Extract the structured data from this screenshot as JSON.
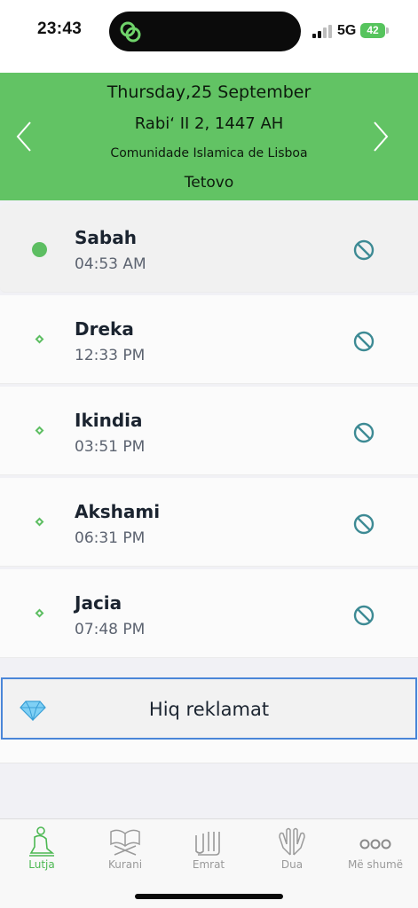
{
  "status_bar": {
    "time": "23:43",
    "network": "5G",
    "battery": "42"
  },
  "header": {
    "gregorian_date": "Thursday,25 September",
    "hijri_date": "Rabiʻ II 2, 1447 AH",
    "calculation_source": "Comunidade Islamica de Lisboa",
    "city": "Tetovo",
    "background_color": "#62c364"
  },
  "prayers": [
    {
      "name": "Sabah",
      "time": "04:53 AM",
      "current": true
    },
    {
      "name": "Dreka",
      "time": "12:33 PM",
      "current": false
    },
    {
      "name": "Ikindia",
      "time": "03:51 PM",
      "current": false
    },
    {
      "name": "Akshami",
      "time": "06:31 PM",
      "current": false
    },
    {
      "name": "Jacia",
      "time": "07:48 PM",
      "current": false
    }
  ],
  "remove_ads": {
    "label": "Hiq reklamat",
    "icon": "diamond-icon"
  },
  "tabs": [
    {
      "label": "Lutja",
      "icon": "praying-person-icon",
      "active": true
    },
    {
      "label": "Kurani",
      "icon": "quran-stand-icon",
      "active": false
    },
    {
      "label": "Emrat",
      "icon": "allah-calligraphy-icon",
      "active": false
    },
    {
      "label": "Dua",
      "icon": "praying-hands-icon",
      "active": false
    },
    {
      "label": "Më shumë",
      "icon": "more-dots-icon",
      "active": false
    }
  ],
  "colors": {
    "accent_green": "#5dbe62",
    "mute_icon": "#3d8a94",
    "ads_border": "#4a86d8",
    "tab_inactive": "#9a9a9a"
  }
}
